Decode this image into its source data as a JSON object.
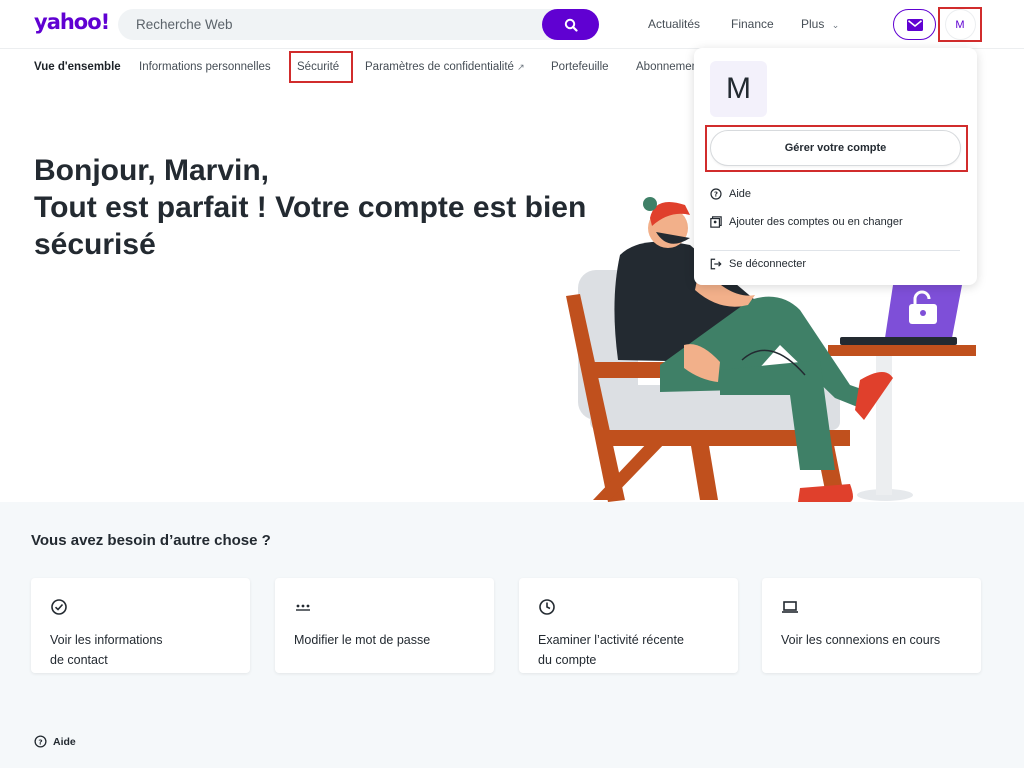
{
  "header": {
    "logo": "yahoo!",
    "search": {
      "placeholder": "Recherche Web"
    },
    "nav": [
      {
        "label": "Actualités"
      },
      {
        "label": "Finance"
      },
      {
        "label": "Plus"
      }
    ],
    "avatar_initial": "M"
  },
  "subnav": {
    "tabs": [
      {
        "label": "Vue d'ensemble"
      },
      {
        "label": "Informations personnelles"
      },
      {
        "label": "Sécurité"
      },
      {
        "label": "Paramètres de confidentialité"
      },
      {
        "label": "Portefeuille"
      },
      {
        "label": "Abonnements"
      }
    ]
  },
  "hero": {
    "line1": "Bonjour, Marvin,",
    "line2": "Tout est parfait ! Votre compte est bien sécurisé"
  },
  "help_section": {
    "title": "Vous avez besoin d’autre chose ?",
    "cards": [
      {
        "icon": "check-circle-icon",
        "label_line1": "Voir les informations",
        "label_line2": "de contact"
      },
      {
        "icon": "password-dots-icon",
        "label_line1": "Modifier le mot de passe",
        "label_line2": ""
      },
      {
        "icon": "clock-icon",
        "label_line1": "Examiner l’activité récente",
        "label_line2": "du compte"
      },
      {
        "icon": "laptop-icon",
        "label_line1": "Voir les connexions en cours",
        "label_line2": ""
      }
    ],
    "aide_label": "Aide"
  },
  "dropdown": {
    "avatar_initial": "M",
    "manage_label": "Gérer votre compte",
    "items": [
      {
        "icon": "question-circle-icon",
        "label": "Aide"
      },
      {
        "icon": "switch-accounts-icon",
        "label": "Ajouter des comptes ou en changer"
      },
      {
        "icon": "sign-out-icon",
        "label": "Se déconnecter"
      }
    ]
  },
  "colors": {
    "brand": "#6001d2",
    "highlight": "#d12c2c"
  }
}
